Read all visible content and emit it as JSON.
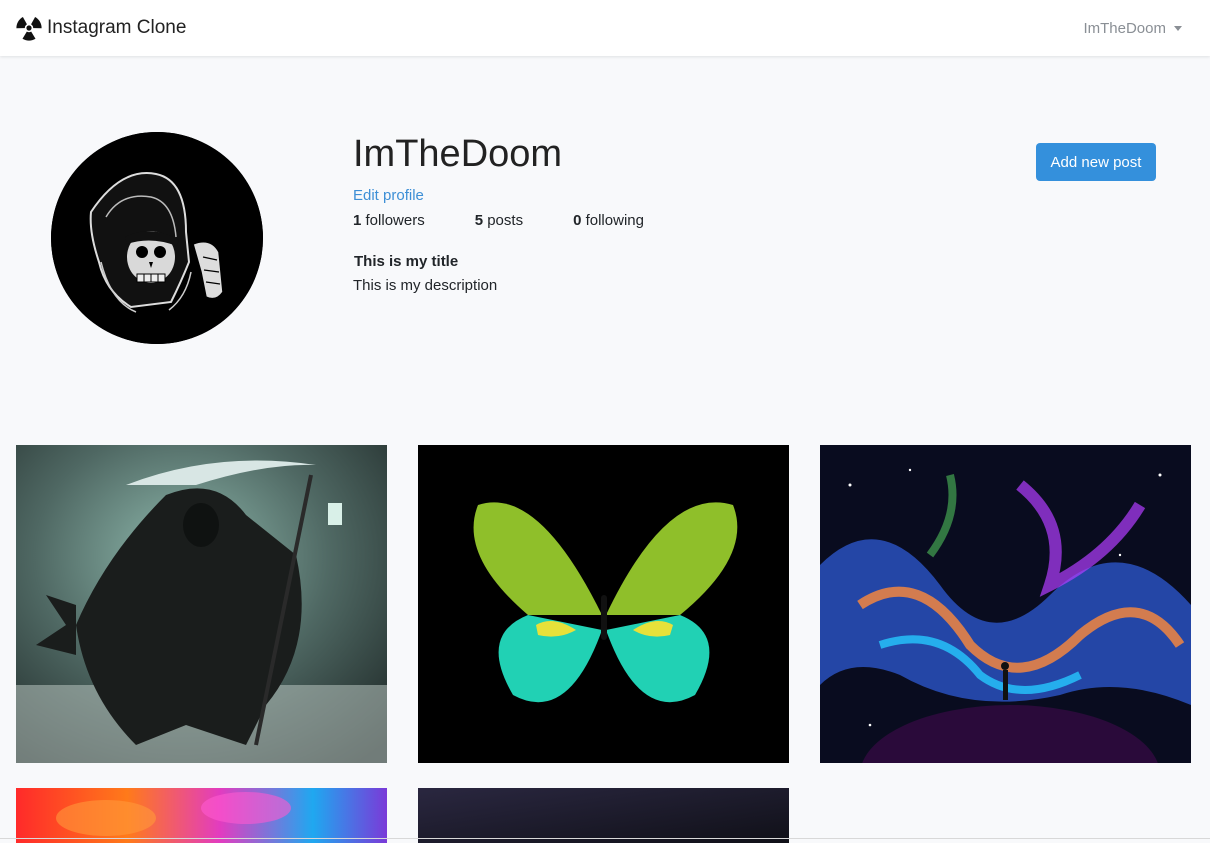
{
  "navbar": {
    "brand": "Instagram Clone",
    "brand_icon": "radiation-icon",
    "user_menu_label": "ImTheDoom"
  },
  "profile": {
    "username": "ImTheDoom",
    "edit_profile_label": "Edit profile",
    "add_post_label": "Add new post",
    "stats": {
      "followers_count": "1",
      "followers_label": "followers",
      "posts_count": "5",
      "posts_label": "posts",
      "following_count": "0",
      "following_label": "following"
    },
    "title": "This is my title",
    "description": "This is my description"
  },
  "colors": {
    "accent": "#3490dc",
    "link": "#3d8fd6",
    "background": "#f8f9fb"
  },
  "posts": [
    {
      "subject": "grim reaper with scythe and lantern"
    },
    {
      "subject": "green and teal butterfly on black"
    },
    {
      "subject": "cosmic nebula with figure on planet"
    },
    {
      "subject": "colorful smoke"
    },
    {
      "subject": "dark gradient"
    }
  ]
}
